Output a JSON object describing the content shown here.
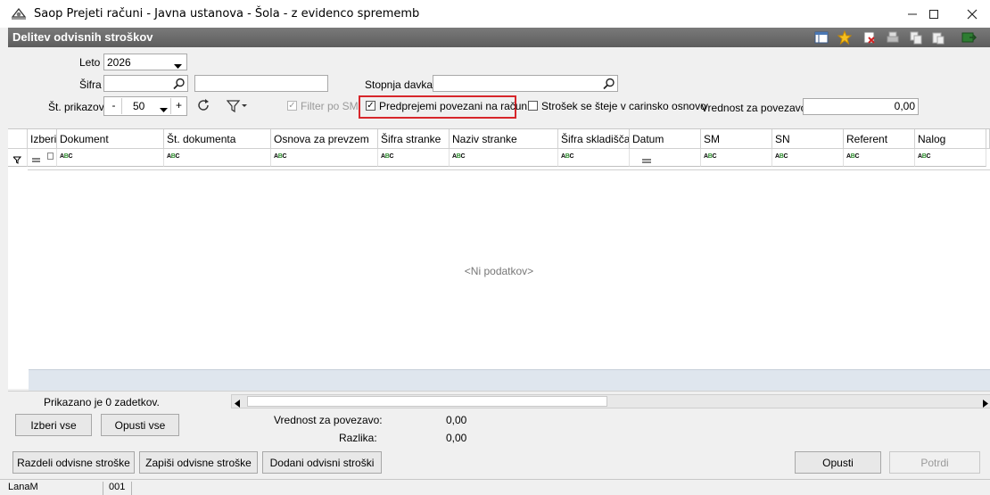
{
  "window": {
    "title": "Saop Prejeti računi - Javna ustanova - Šola - z evidenco sprememb"
  },
  "section": {
    "title": "Delitev odvisnih stroškov"
  },
  "toolbar_icons": [
    "grid-settings-icon",
    "star-icon",
    "delete-icon",
    "print-icon",
    "copy-icon",
    "paste-icon",
    "export-icon"
  ],
  "form": {
    "leto_label": "Leto",
    "leto_value": "2026",
    "sifra_label": "Šifra",
    "sifra_value": "",
    "sifra_desc_value": "",
    "stopnja_label": "Stopnja davka",
    "stopnja_value": "",
    "prikazov_label": "Št. prikazov",
    "minus": "-",
    "prikazov_value": "50",
    "plus": "+",
    "filter_sm_label": "Filter po SM",
    "predprejemi_label": "Predprejemi povezani na račun",
    "strosek_label": "Strošek se šteje v carinsko osnovo",
    "vrednost_label": "Vrednost za povezavo",
    "vrednost_value": "0,00"
  },
  "grid": {
    "columns": [
      "Izberi",
      "Dokument",
      "Št. dokumenta",
      "Osnova za prevzem",
      "Šifra stranke",
      "Naziv stranke",
      "Šifra skladišča",
      "Datum",
      "SM",
      "SN",
      "Referent",
      "Nalog"
    ],
    "empty_text": "<Ni podatkov>",
    "status_text": "Prikazano je 0 zadetkov."
  },
  "summary": {
    "izberi_vse": "Izberi vse",
    "opusti_vse": "Opusti vse",
    "vrednost_label": "Vrednost za povezavo:",
    "vrednost_value": "0,00",
    "razlika_label": "Razlika:",
    "razlika_value": "0,00"
  },
  "buttons": {
    "razdeli": "Razdeli odvisne stroške",
    "zapisi": "Zapiši odvisne stroške",
    "dodani": "Dodani odvisni stroški",
    "opusti": "Opusti",
    "potrdi": "Potrdi"
  },
  "footer": {
    "user": "LanaM",
    "code": "001"
  }
}
